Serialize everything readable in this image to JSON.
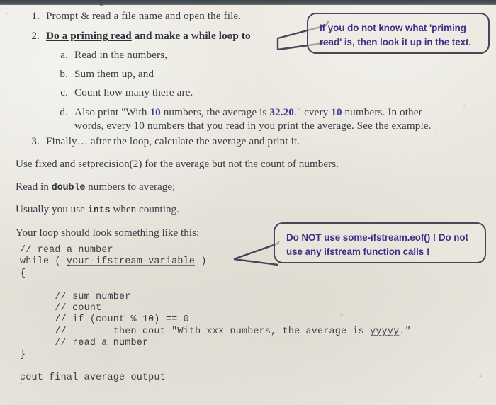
{
  "document": {
    "top_glyph": "o",
    "list": [
      {
        "marker": "1.",
        "text": "Prompt & read a file name and open the file."
      },
      {
        "marker": "2.",
        "bold_underlined": "Do a priming read",
        "bold_rest": " and make a while loop to"
      },
      {
        "marker": "3.",
        "text": "Finally… after the loop, calculate the average and print it."
      }
    ],
    "sublist": [
      {
        "marker": "a.",
        "text": "Read in the numbers,"
      },
      {
        "marker": "b.",
        "text": "Sum them up, and"
      },
      {
        "marker": "c.",
        "text": "Count how many there are."
      },
      {
        "marker": "d.",
        "seg1": "Also print \"With ",
        "hl1": "10",
        "seg2": " numbers, the average is ",
        "hl2": "32.20",
        "seg3": ".\" every ",
        "hl3": "10",
        "seg4": " numbers. In other",
        "line2": "words, every 10 numbers that you read in you print the average. See the example."
      }
    ],
    "paragraphs": {
      "fixed_precision": "Use fixed and setprecision(2) for the average but not the count of numbers.",
      "read_in_pre": "Read in ",
      "read_in_mono": "double",
      "read_in_post": " numbers to average;",
      "usually_pre": "Usually you use ",
      "usually_mono": "ints",
      "usually_post": " when counting.",
      "your_loop": "Your loop should look something like this:"
    },
    "code": {
      "line1": "// read a number",
      "line2_pre": "while ( ",
      "line2_sq": "your-ifstream-variable",
      "line2_post": " )",
      "line3": "{",
      "line4": "      // sum number",
      "line5": "      // count",
      "line6": "      // if (count % 10) == 0",
      "line7_pre": "      //        then cout \"With xxx numbers, the average is ",
      "line7_sq": "yyyyy",
      "line7_post": ".\"",
      "line8": "      // read a number",
      "line9": "}",
      "line10": "cout final average output"
    },
    "callouts": [
      {
        "name": "priming-read-callout",
        "line1": "If you do not know what 'priming",
        "line2": "read' is, then look it up in the text."
      },
      {
        "name": "eof-warning-callout",
        "line1": "Do NOT use some-ifstream.eof() ! Do not",
        "line2": "use any ifstream function calls !"
      }
    ],
    "colors": {
      "paper": "#e8e5dd",
      "ink": "#3a3d46",
      "highlight": "#3b3a93",
      "callout_text": "#3f2f86",
      "callout_border": "#4a4558",
      "top_bar": "#4a5357"
    }
  }
}
